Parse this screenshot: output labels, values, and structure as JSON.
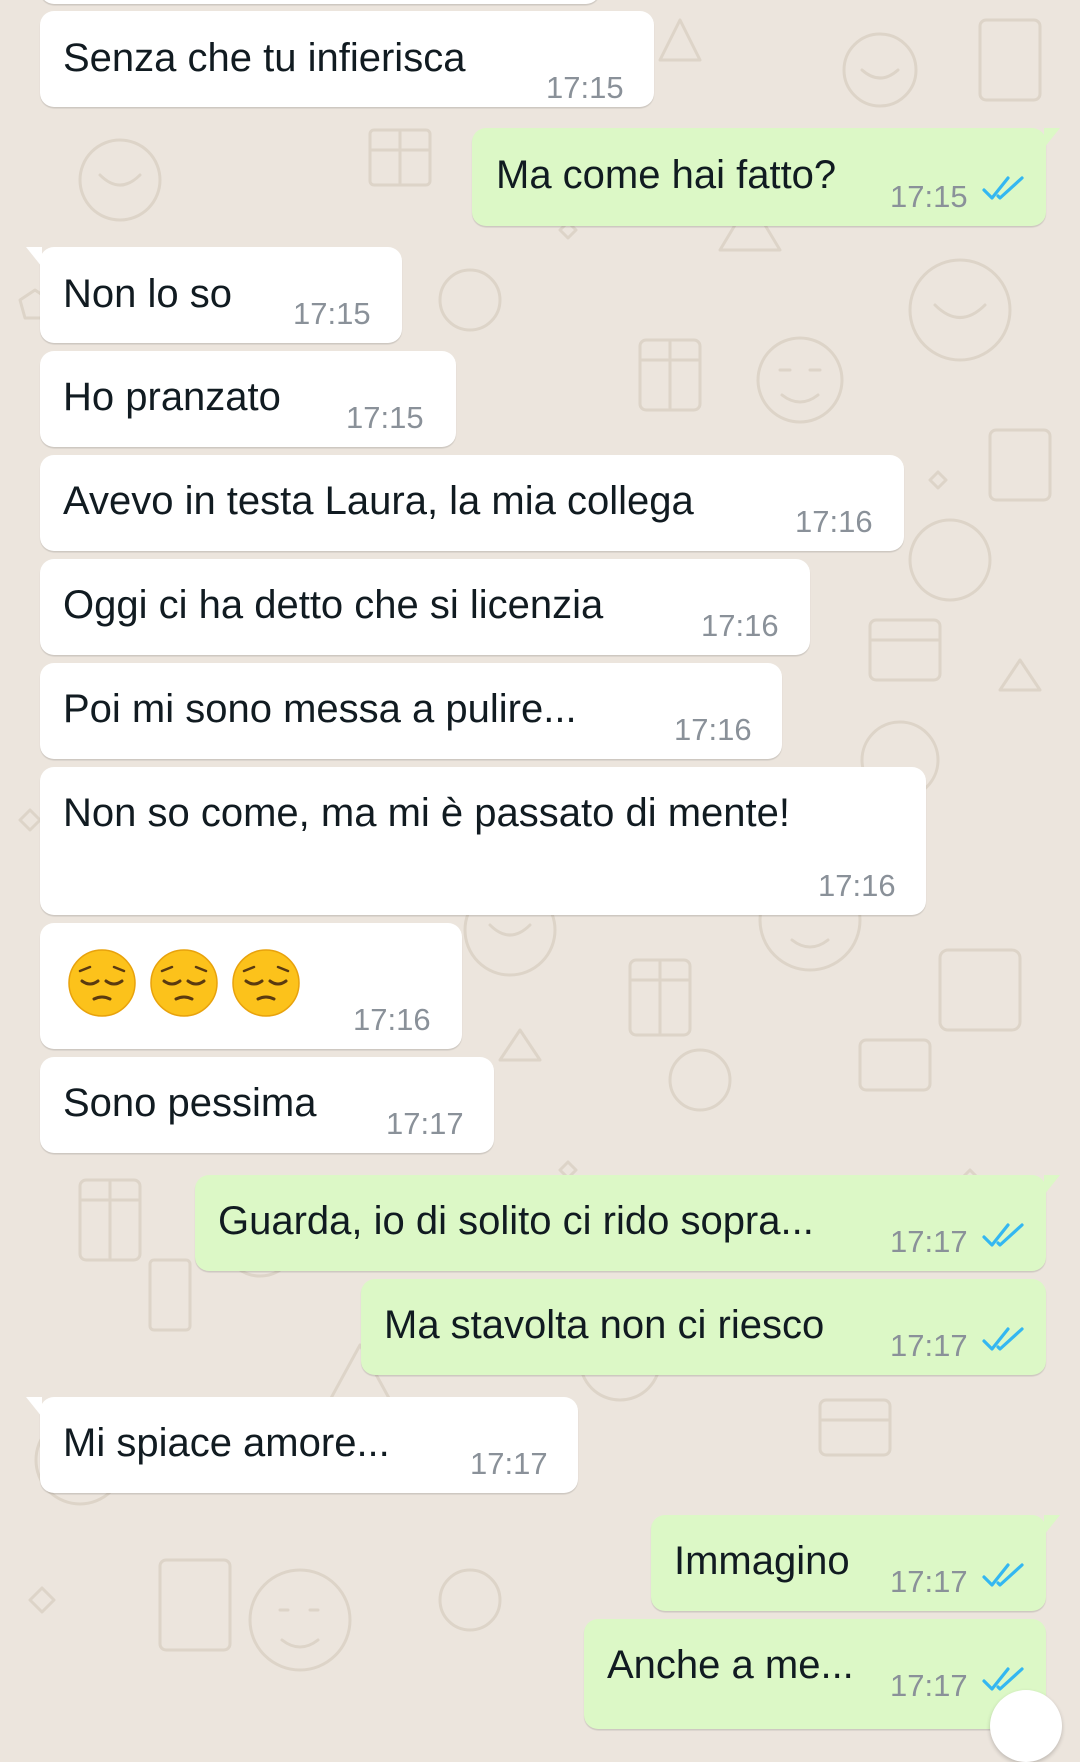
{
  "chat": {
    "messages": [
      {
        "text": "Senza che tu infierisca",
        "time": "17:15"
      },
      {
        "text": "Ma come hai fatto?",
        "time": "17:15"
      },
      {
        "text": "Non lo so",
        "time": "17:15"
      },
      {
        "text": "Ho pranzato",
        "time": "17:15"
      },
      {
        "text": "Avevo in testa Laura, la mia collega",
        "time": "17:16"
      },
      {
        "text": "Oggi ci ha detto che si licenzia",
        "time": "17:16"
      },
      {
        "text": "Poi mi sono messa a pulire...",
        "time": "17:16"
      },
      {
        "text": "Non so come, ma mi è passato di mente!",
        "time": "17:16"
      },
      {
        "emoji": [
          "pensive-face",
          "pensive-face",
          "pensive-face"
        ],
        "time": "17:16"
      },
      {
        "text": "Sono pessima",
        "time": "17:17"
      },
      {
        "text": "Guarda, io di solito ci rido sopra...",
        "time": "17:17"
      },
      {
        "text": "Ma stavolta non ci riesco",
        "time": "17:17"
      },
      {
        "text": "Mi spiace amore...",
        "time": "17:17"
      },
      {
        "text": "Immagino",
        "time": "17:17"
      },
      {
        "text": "Anche a me...",
        "time": "17:17"
      }
    ]
  },
  "colors": {
    "background": "#ece5dd",
    "incoming_bubble": "#ffffff",
    "outgoing_bubble": "#dcf8c6",
    "read_ticks": "#34b7f1",
    "timestamp": "#8a9199"
  }
}
